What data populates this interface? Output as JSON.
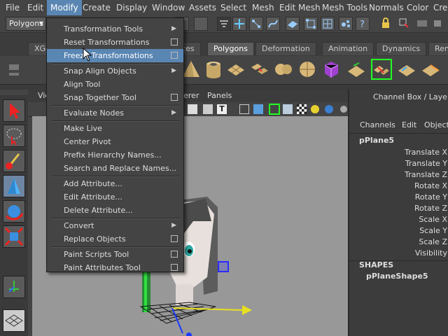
{
  "menubar": [
    "File",
    "Edit",
    "Modify",
    "Create",
    "Display",
    "Window",
    "Assets",
    "Select",
    "Mesh",
    "Edit Mesh",
    "Mesh Tools",
    "Normals",
    "Color",
    "Crea"
  ],
  "status_line": {
    "menuset": "Polygons"
  },
  "shelf_tabs": [
    "XGe",
    "ces",
    "Polygons",
    "Deformation",
    "Animation",
    "Dynamics",
    "Ren"
  ],
  "viewport": {
    "menu_left": "Vie",
    "menu_items": [
      "erer",
      "Panels"
    ]
  },
  "channel_box": {
    "header": "Channel Box / Layer Edi",
    "menus": [
      "Channels",
      "Edit",
      "Object"
    ],
    "object_name": "pPlane5",
    "attributes": [
      "Translate X",
      "Translate Y",
      "Translate Z",
      "Rotate X",
      "Rotate Y",
      "Rotate Z",
      "Scale X",
      "Scale Y",
      "Scale Z",
      "Visibility"
    ],
    "shapes_label": "SHAPES",
    "shape_name": "pPlaneShape5"
  },
  "modify_menu": {
    "items": [
      {
        "label": "Transformation Tools",
        "submenu": true
      },
      {
        "label": "Reset Transformations",
        "option": true
      },
      {
        "label": "Freeze Transformations",
        "option": true,
        "highlight": true
      },
      {
        "sep": true
      },
      {
        "label": "Snap Align Objects",
        "submenu": true
      },
      {
        "label": "Align Tool"
      },
      {
        "label": "Snap Together Tool",
        "option": true
      },
      {
        "sep": true
      },
      {
        "label": "Evaluate Nodes",
        "submenu": true
      },
      {
        "sep": true
      },
      {
        "label": "Make Live"
      },
      {
        "label": "Center Pivot"
      },
      {
        "label": "Prefix Hierarchy Names..."
      },
      {
        "label": "Search and Replace Names..."
      },
      {
        "sep": true
      },
      {
        "label": "Add Attribute..."
      },
      {
        "label": "Edit Attribute..."
      },
      {
        "label": "Delete Attribute..."
      },
      {
        "sep": true
      },
      {
        "label": "Convert",
        "submenu": true
      },
      {
        "label": "Replace Objects",
        "option": true
      },
      {
        "sep": true
      },
      {
        "label": "Paint Scripts Tool",
        "option": true
      },
      {
        "label": "Paint Attributes Tool",
        "option": true
      }
    ]
  },
  "colors": {
    "highlight": "#5a86b3",
    "panel": "#444444",
    "viewport": "#989898"
  }
}
